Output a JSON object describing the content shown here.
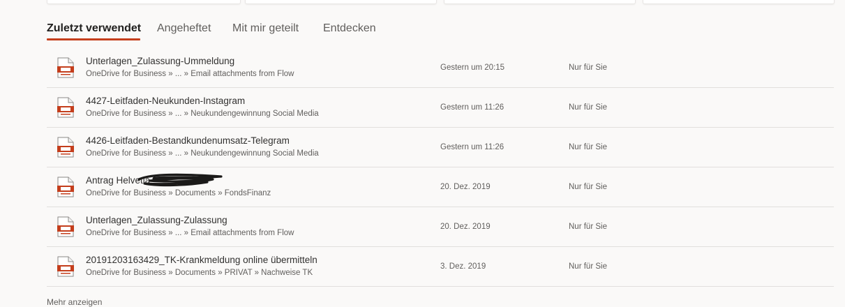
{
  "tabs": [
    {
      "label": "Zuletzt verwendet",
      "active": true
    },
    {
      "label": "Angeheftet",
      "active": false
    },
    {
      "label": "Mit mir geteilt",
      "active": false
    },
    {
      "label": "Entdecken",
      "active": false
    }
  ],
  "accent_color": "#c43e1c",
  "file_icon": "powerpoint-file-icon",
  "files": [
    {
      "name": "Unterlagen_Zulassung-Ummeldung",
      "path": "OneDrive for Business » ... » Email attachments from Flow",
      "date": "Gestern um 20:15",
      "sharing": "Nur für Sie"
    },
    {
      "name": "4427-Leitfaden-Neukunden-Instagram",
      "path": "OneDrive for Business » ... » Neukundengewinnung Social Media",
      "date": "Gestern um 11:26",
      "sharing": "Nur für Sie"
    },
    {
      "name": "4426-Leitfaden-Bestandkundenumsatz-Telegram",
      "path": "OneDrive for Business » ... » Neukundengewinnung Social Media",
      "date": "Gestern um 11:26",
      "sharing": "Nur für Sie"
    },
    {
      "name": "Antrag Helvetia",
      "path": "OneDrive for Business » Documents » FondsFinanz",
      "date": "20. Dez. 2019",
      "sharing": "Nur für Sie"
    },
    {
      "name": "Unterlagen_Zulassung-Zulassung",
      "path": "OneDrive for Business » ... » Email attachments from Flow",
      "date": "20. Dez. 2019",
      "sharing": "Nur für Sie"
    },
    {
      "name": "20191203163429_TK-Krankmeldung online übermitteln",
      "path": "OneDrive for Business » Documents » PRIVAT » Nachweise TK",
      "date": "3. Dez. 2019",
      "sharing": "Nur für Sie"
    }
  ],
  "footer": {
    "more_label": "Mehr anzeigen"
  }
}
